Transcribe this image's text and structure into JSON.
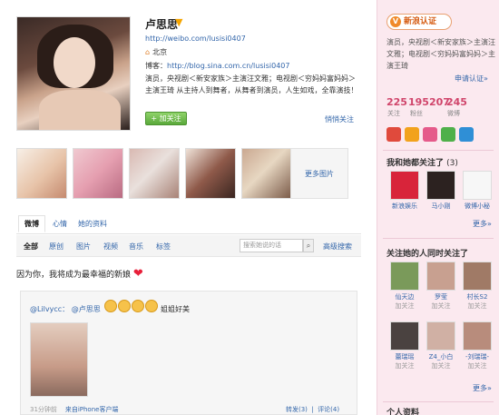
{
  "profile": {
    "name": "卢思思",
    "url": "http://weibo.com/lusisi0407",
    "location": "北京",
    "blog_label": "博客：",
    "blog_url": "http://blog.sina.com.cn/lusisi0407",
    "bio": "演员，央视剧＜新安家族＞主演汪文雅；电视剧＜穷妈妈富妈妈＞主演王琦 从主持人到舞者，从舞者到演员，人生如戏，全靠演技！",
    "follow_button": "+ 加关注",
    "quiet_follow": "悄悄关注"
  },
  "photos": {
    "more": "更多图片"
  },
  "tabs": [
    "微博",
    "心情",
    "她的资料"
  ],
  "filters": [
    "全部",
    "原创",
    "图片",
    "视频",
    "音乐",
    "标签"
  ],
  "search": {
    "placeholder": "搜索她说的话",
    "advanced": "高级搜索"
  },
  "feed": {
    "post_text": "因为你，我将成为最幸福的新娘",
    "repost": {
      "author": "@Lilvycc：",
      "mention": "@卢思思",
      "quote": "姐姐好美",
      "time": "31分钟前",
      "source": "来自iPhone客户端",
      "forward": "转发(3)",
      "comment": "评论(4)"
    }
  },
  "sidebar": {
    "cert_label": "新浪认证",
    "cert_text": "演员，央视剧＜新安家族＞主演汪文雅；电视剧＜穷妈妈富妈妈＞主演王琦",
    "apply": "申请认证»",
    "stats": [
      {
        "num": "225",
        "label": "关注"
      },
      {
        "num": "195207",
        "label": "粉丝"
      },
      {
        "num": "245",
        "label": "微博"
      }
    ],
    "common_follow_title": "我和她都关注了",
    "common_follow_count": "(3)",
    "common_follow": [
      "新浪娱乐",
      "马小刚",
      "微博小秘"
    ],
    "common_more": "更多»",
    "same_time_title": "关注她的人同时关注了",
    "people": [
      {
        "name": "仙天边",
        "add": "加关注"
      },
      {
        "name": "罗莹",
        "add": "加关注"
      },
      {
        "name": "村长S2",
        "add": "加关注"
      },
      {
        "name": "蕾瑞瑶",
        "add": "加关注"
      },
      {
        "name": "Z4_小白",
        "add": "加关注"
      },
      {
        "name": "-刘瑞瑞-",
        "add": "加关注"
      }
    ],
    "people_more": "更多»",
    "bottom_title": "个人资料"
  },
  "colors": {
    "link": "#3366aa",
    "stat": "#d0456b",
    "sidebar_bg": "#fbe9ef"
  }
}
